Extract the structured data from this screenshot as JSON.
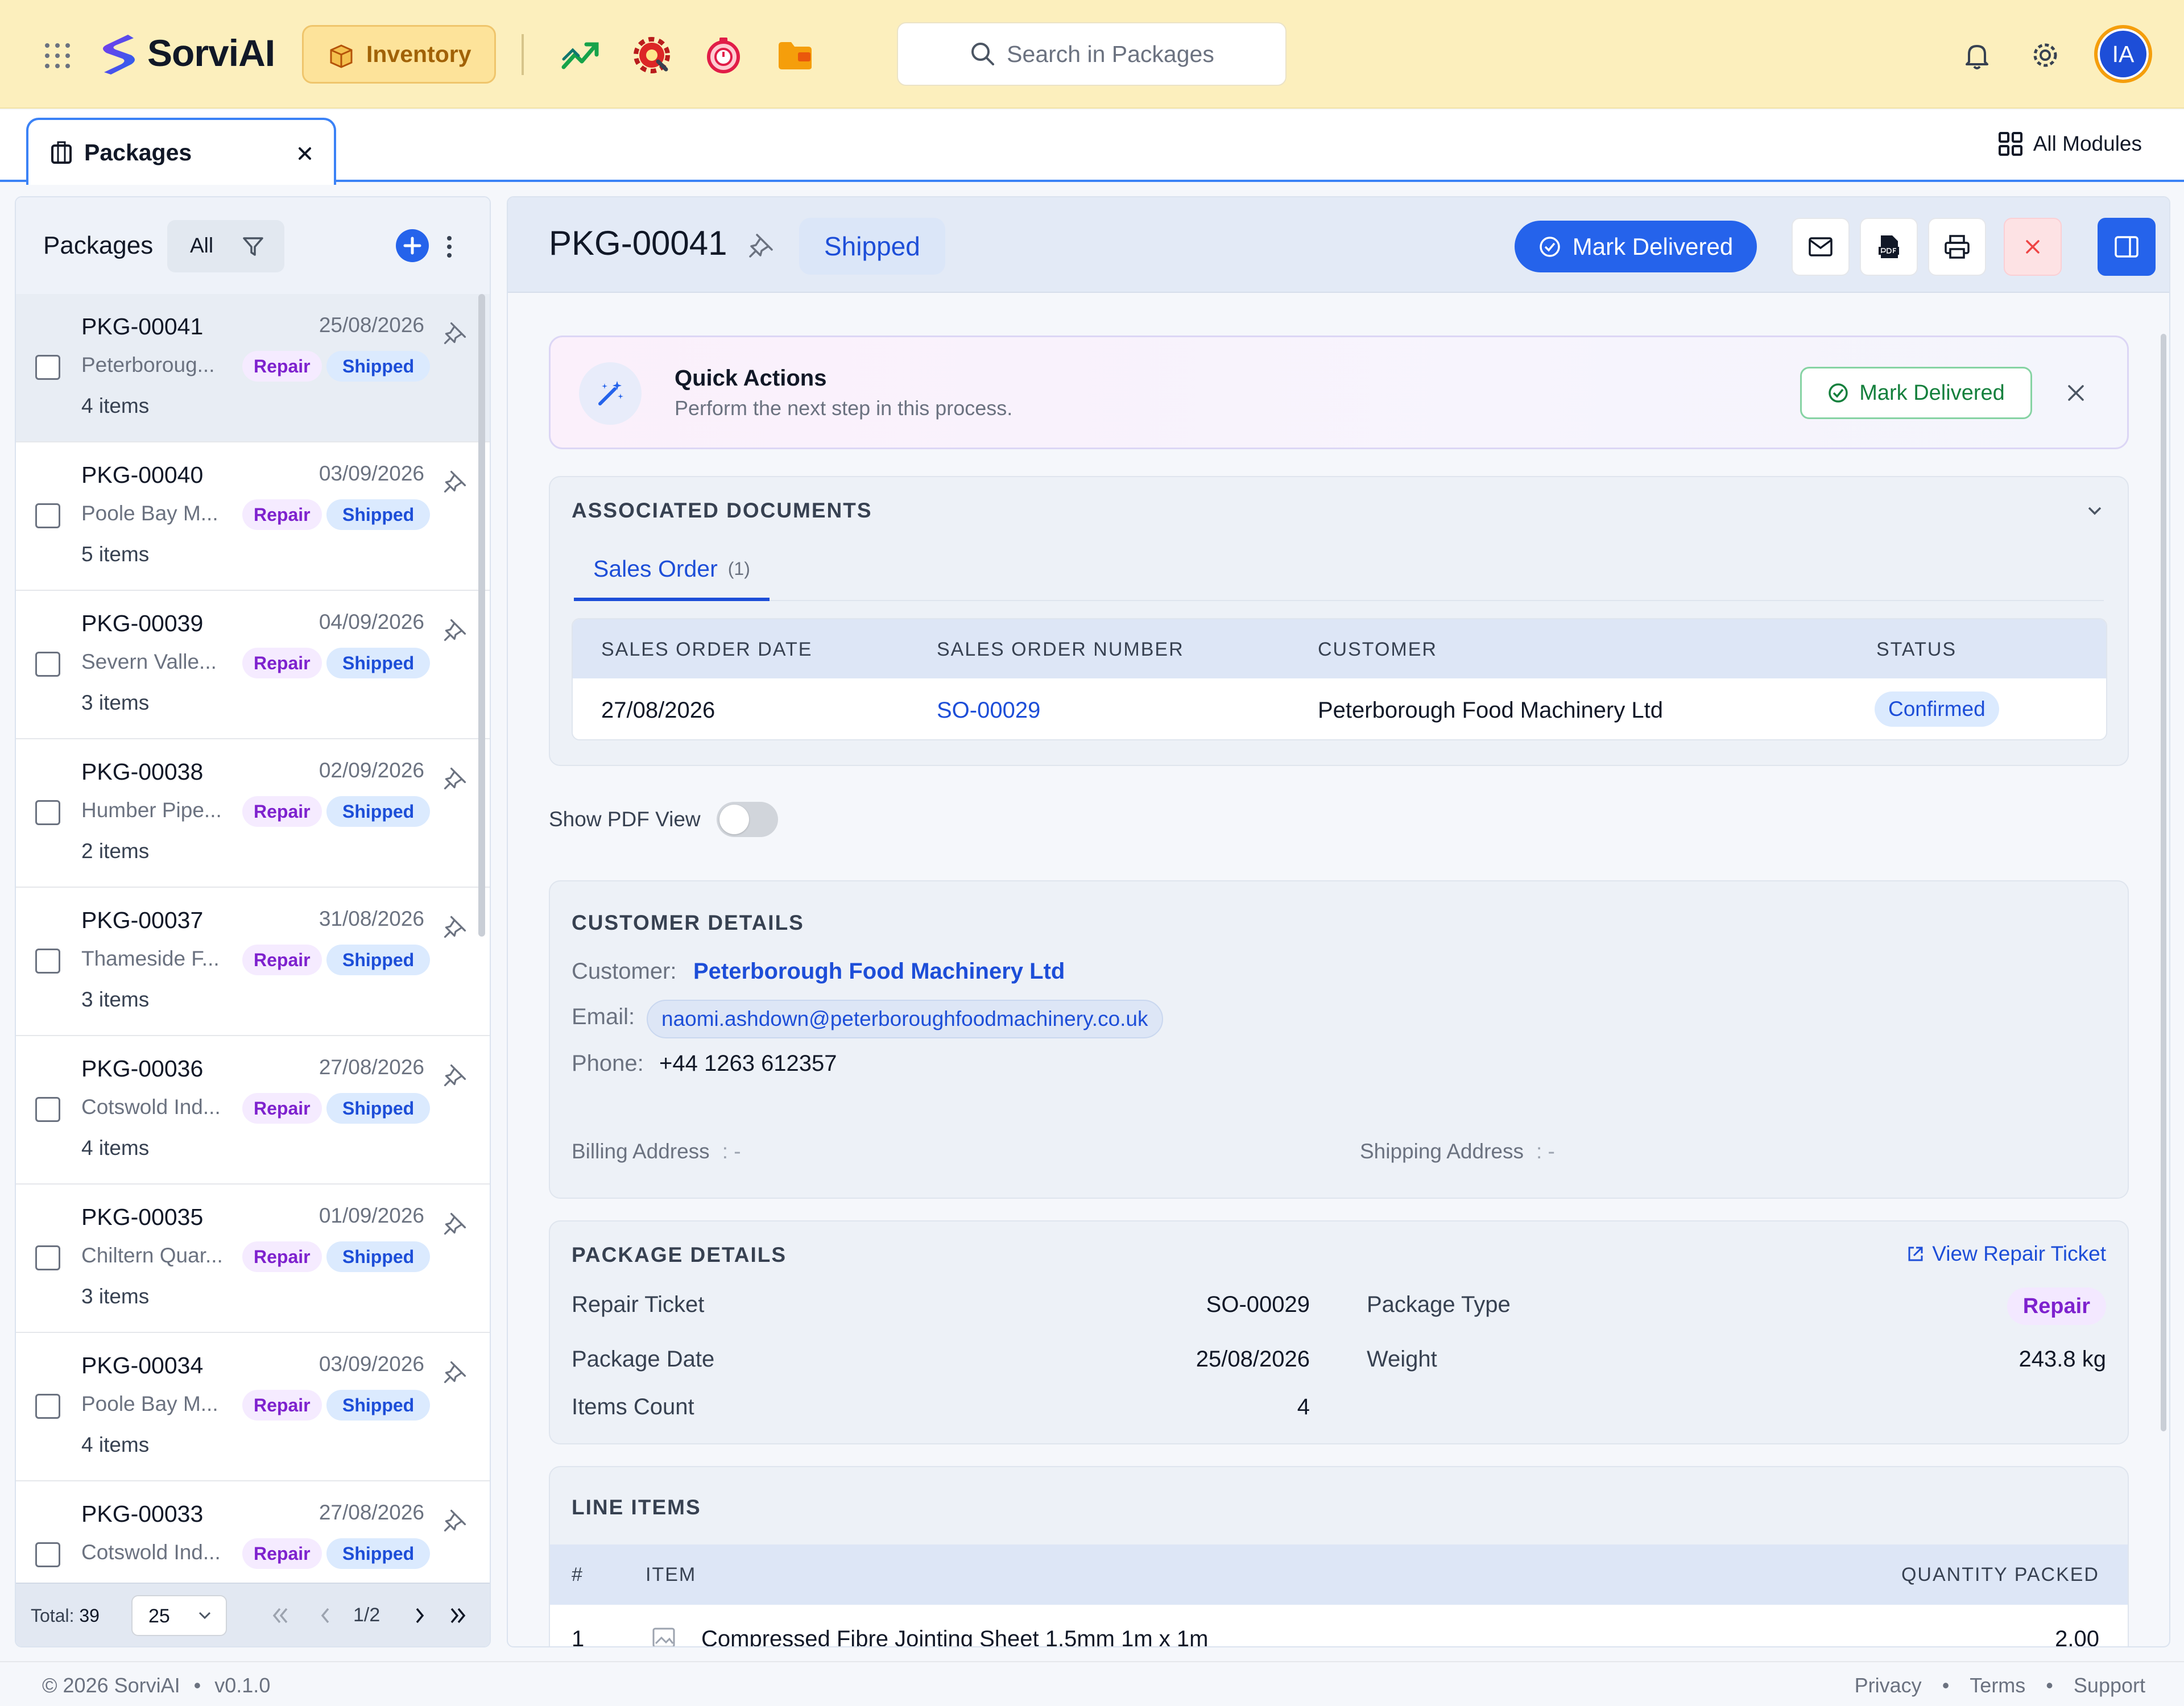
{
  "app": {
    "brand": "SorviAI",
    "module": "Inventory",
    "search_placeholder": "Search in Packages",
    "avatar_initials": "IA",
    "all_modules": "All Modules"
  },
  "tab": {
    "label": "Packages"
  },
  "list": {
    "title": "Packages",
    "filter_all": "All",
    "items": [
      {
        "number": "PKG-00041",
        "date": "25/08/2026",
        "customer": "Peterboroug...",
        "type": "Repair",
        "status": "Shipped",
        "count": "4 items"
      },
      {
        "number": "PKG-00040",
        "date": "03/09/2026",
        "customer": "Poole Bay M...",
        "type": "Repair",
        "status": "Shipped",
        "count": "5 items"
      },
      {
        "number": "PKG-00039",
        "date": "04/09/2026",
        "customer": "Severn Valle...",
        "type": "Repair",
        "status": "Shipped",
        "count": "3 items"
      },
      {
        "number": "PKG-00038",
        "date": "02/09/2026",
        "customer": "Humber Pipe...",
        "type": "Repair",
        "status": "Shipped",
        "count": "2 items"
      },
      {
        "number": "PKG-00037",
        "date": "31/08/2026",
        "customer": "Thameside F...",
        "type": "Repair",
        "status": "Shipped",
        "count": "3 items"
      },
      {
        "number": "PKG-00036",
        "date": "27/08/2026",
        "customer": "Cotswold Ind...",
        "type": "Repair",
        "status": "Shipped",
        "count": "4 items"
      },
      {
        "number": "PKG-00035",
        "date": "01/09/2026",
        "customer": "Chiltern Quar...",
        "type": "Repair",
        "status": "Shipped",
        "count": "3 items"
      },
      {
        "number": "PKG-00034",
        "date": "03/09/2026",
        "customer": "Poole Bay M...",
        "type": "Repair",
        "status": "Shipped",
        "count": "4 items"
      },
      {
        "number": "PKG-00033",
        "date": "27/08/2026",
        "customer": "Cotswold Ind...",
        "type": "Repair",
        "status": "Shipped",
        "count": ""
      }
    ],
    "footer": {
      "total_label": "Total:",
      "total": "39",
      "page_size": "25",
      "page_info": "1/2"
    }
  },
  "detail": {
    "number": "PKG-00041",
    "status": "Shipped",
    "mark_delivered": "Mark Delivered",
    "quick_actions": {
      "title": "Quick Actions",
      "subtitle": "Perform the next step in this process.",
      "button": "Mark Delivered"
    },
    "assoc": {
      "title": "ASSOCIATED DOCUMENTS",
      "tab_label": "Sales Order",
      "tab_count": "(1)",
      "headers": [
        "SALES ORDER DATE",
        "SALES ORDER NUMBER",
        "CUSTOMER",
        "STATUS"
      ],
      "row": {
        "date": "27/08/2026",
        "number": "SO-00029",
        "customer": "Peterborough Food Machinery Ltd",
        "status": "Confirmed"
      }
    },
    "pdf_toggle": "Show PDF View",
    "customer": {
      "title": "CUSTOMER DETAILS",
      "customer_label": "Customer:",
      "customer_value": "Peterborough Food Machinery Ltd",
      "email_label": "Email:",
      "email_value": "naomi.ashdown@peterboroughfoodmachinery.co.uk",
      "phone_label": "Phone:",
      "phone_value": "+44 1263 612357",
      "billing_label": "Billing Address",
      "billing_value": ": -",
      "shipping_label": "Shipping Address",
      "shipping_value": ": -"
    },
    "package": {
      "title": "PACKAGE DETAILS",
      "view_ticket": "View Repair Ticket",
      "repair_ticket_label": "Repair Ticket",
      "repair_ticket_value": "SO-00029",
      "package_type_label": "Package Type",
      "package_type_value": "Repair",
      "package_date_label": "Package Date",
      "package_date_value": "25/08/2026",
      "weight_label": "Weight",
      "weight_value": "243.8 kg",
      "items_count_label": "Items Count",
      "items_count_value": "4"
    },
    "line_items": {
      "title": "LINE ITEMS",
      "col_num": "#",
      "col_item": "ITEM",
      "col_qty": "QUANTITY PACKED",
      "first_row": {
        "num": "1",
        "item": "Compressed Fibre Jointing Sheet 1.5mm 1m x 1m",
        "qty": "2.00"
      }
    }
  },
  "footer": {
    "copyright": "© 2026 SorviAI",
    "version": "v0.1.0",
    "links": [
      "Privacy",
      "Terms",
      "Support"
    ]
  },
  "colors": {
    "accent": "#2563eb",
    "topbar": "#fcefbd",
    "shipped": "#1d4ed8",
    "repair": "#7e22ce"
  }
}
